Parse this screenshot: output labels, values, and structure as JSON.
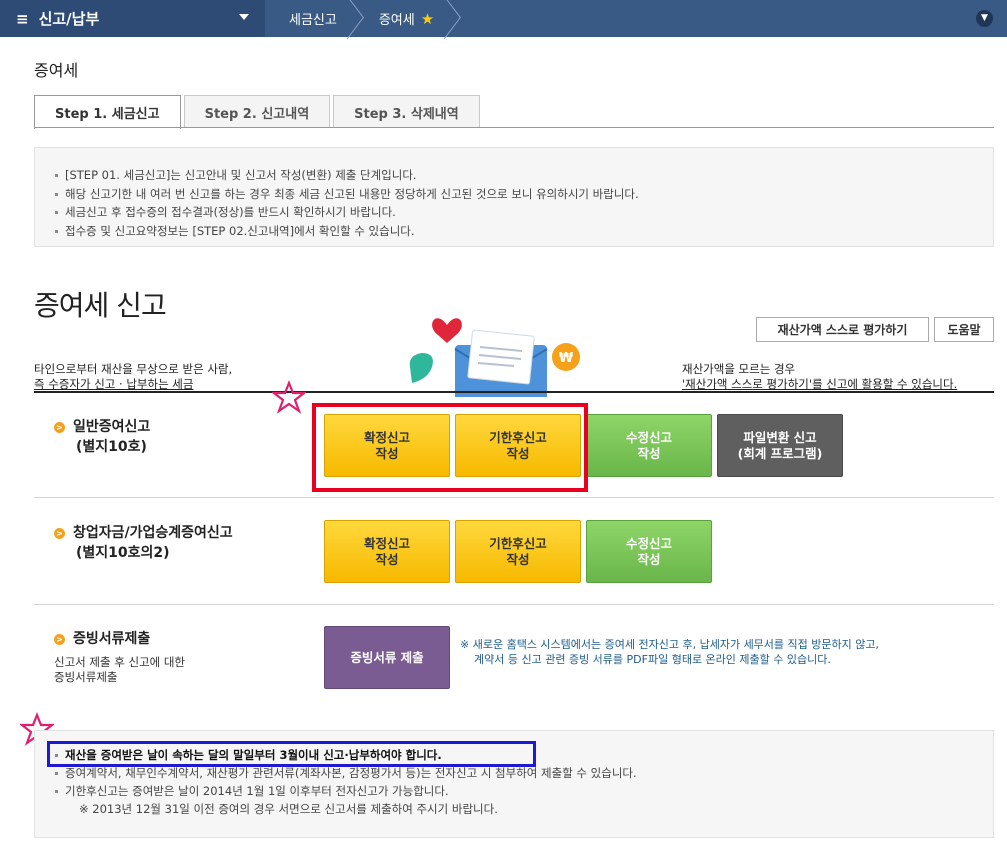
{
  "nav": {
    "menu_label": "신고/납부",
    "crumbs": [
      "세금신고",
      "증여세"
    ]
  },
  "page_title": "증여세",
  "tabs": [
    "Step 1. 세금신고",
    "Step 2. 신고내역",
    "Step 3. 삭제내역"
  ],
  "info_items": [
    "[STEP 01. 세금신고]는 신고안내 및 신고서 작성(변환) 제출 단계입니다.",
    "해당 신고기한 내 여러 번 신고를 하는 경우 최종 세금 신고된 내용만 정당하게 신고된 것으로 보니 유의하시기 바랍니다.",
    "세금신고 후 접수증의 접수결과(정상)를 반드시 확인하시기 바랍니다.",
    "접수증 및 신고요약정보는 [STEP 02.신고내역]에서 확인할 수 있습니다."
  ],
  "big_title": "증여세 신고",
  "tools": {
    "self_eval": "재산가액 스스로 평가하기",
    "help": "도움말"
  },
  "desc_left": {
    "line1": "타인으로부터 재산을 무상으로 받은 사람,",
    "line2": "즉 수증자가 신고 · 납부하는 세금"
  },
  "desc_right": {
    "line1": "재산가액을 모르는 경우",
    "line2": "'재산가액 스스로 평가하기'를 신고에 활용할 수 있습니다."
  },
  "sections": {
    "general": {
      "title": "일반증여신고",
      "sub": "(별지10호)",
      "btn_confirm": "확정신고\n작성",
      "btn_late": "기한후신고\n작성",
      "btn_amend": "수정신고\n작성",
      "btn_file": "파일변환 신고\n(회계 프로그램)"
    },
    "startup": {
      "title": "창업자금/가업승계증여신고",
      "sub": "(별지10호의2)",
      "btn_confirm": "확정신고\n작성",
      "btn_late": "기한후신고\n작성",
      "btn_amend": "수정신고\n작성"
    },
    "evidence": {
      "title": "증빙서류제출",
      "note1": "신고서 제출 후 신고에 대한",
      "note2": "증빙서류제출",
      "btn_submit": "증빙서류 제출",
      "bluenote1": "※ 새로운 홈택스 시스템에서는 증여세 전자신고 후, 납세자가 세무서를 직접 방문하지 않고,",
      "bluenote2": "계약서 등 신고 관련 증빙 서류를 PDF파일 형태로 온라인 제출할 수 있습니다."
    }
  },
  "bottom_notes": [
    "재산을 증여받은 날이 속하는 달의 말일부터 3월이내 신고·납부하여야 합니다.",
    "증여계약서, 채무인수계약서, 재산평가 관련서류(계좌사본, 감정평가서 등)는 전자신고 시 첨부하여 제출할 수 있습니다.",
    "기한후신고는 증여받은 날이 2014년 1월 1일 이후부터 전자신고가 가능합니다.",
    "※ 2013년 12월 31일 이전 증여의 경우 서면으로 신고서를 제출하여 주시기 바랍니다."
  ],
  "colors": {
    "nav_bg": "#3a5a86",
    "highlight_red": "#e8001e",
    "highlight_blue": "#1f19d6",
    "btn_yellow": "#f7b900",
    "btn_green": "#6ab64a",
    "btn_purple": "#7a5b92"
  }
}
